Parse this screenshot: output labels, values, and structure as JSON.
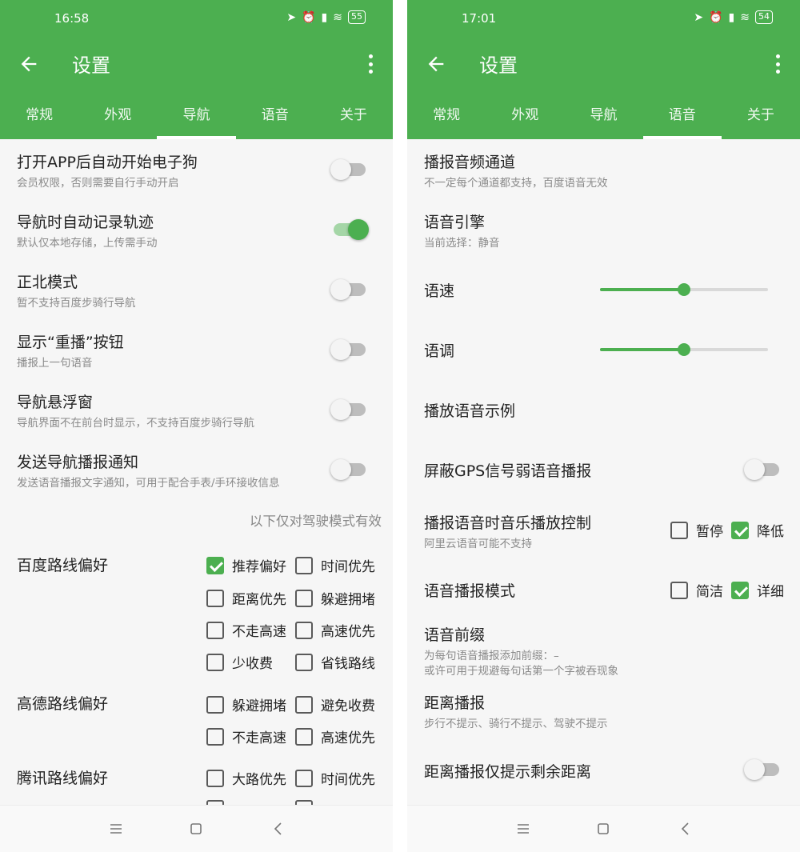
{
  "status": {
    "left_time": "16:58",
    "right_time": "17:01",
    "left_battery": "55",
    "right_battery": "54"
  },
  "appbar": {
    "title": "设置"
  },
  "tabs": [
    "常规",
    "外观",
    "导航",
    "语音",
    "关于"
  ],
  "colors": {
    "primary": "#4caf50",
    "background": "#f6f6f6",
    "text": "#222222",
    "subtext": "#8a8a8a"
  },
  "icons": {
    "back": "arrow-left-icon",
    "menu": "more-vert-icon",
    "nav_menu": "hamburger-icon",
    "nav_home": "square-icon",
    "nav_back": "chevron-left-icon"
  },
  "left": {
    "active_tab": "导航",
    "toggles": [
      {
        "title": "打开APP后自动开始电子狗",
        "subtitle": "会员权限，否则需要自行手动开启",
        "on": false
      },
      {
        "title": "导航时自动记录轨迹",
        "subtitle": "默认仅本地存储，上传需手动",
        "on": true
      },
      {
        "title": "正北模式",
        "subtitle": "暂不支持百度步骑行导航",
        "on": false
      },
      {
        "title": "显示“重播”按钮",
        "subtitle": "播报上一句语音",
        "on": false
      },
      {
        "title": "导航悬浮窗",
        "subtitle": "导航界面不在前台时显示，不支持百度步骑行导航",
        "on": false
      },
      {
        "title": "发送导航播报通知",
        "subtitle": "发送语音播报文字通知，可用于配合手表/手环接收信息",
        "on": false
      }
    ],
    "driving_note": "以下仅对驾驶模式有效",
    "baidu": {
      "label": "百度路线偏好",
      "options": [
        {
          "label": "推荐偏好",
          "checked": true
        },
        {
          "label": "时间优先",
          "checked": false
        },
        {
          "label": "距离优先",
          "checked": false
        },
        {
          "label": "躲避拥堵",
          "checked": false
        },
        {
          "label": "不走高速",
          "checked": false
        },
        {
          "label": "高速优先",
          "checked": false
        },
        {
          "label": "少收费",
          "checked": false
        },
        {
          "label": "省钱路线",
          "checked": false
        }
      ]
    },
    "gaode": {
      "label": "高德路线偏好",
      "options": [
        {
          "label": "躲避拥堵",
          "checked": false
        },
        {
          "label": "避免收费",
          "checked": false
        },
        {
          "label": "不走高速",
          "checked": false
        },
        {
          "label": "高速优先",
          "checked": false
        }
      ]
    },
    "tencent": {
      "label": "腾讯路线偏好",
      "options": [
        {
          "label": "大路优先",
          "checked": false
        },
        {
          "label": "时间优先",
          "checked": false
        }
      ]
    }
  },
  "right": {
    "active_tab": "语音",
    "audio_channel": {
      "title": "播报音频通道",
      "subtitle": "不一定每个通道都支持，百度语音无效"
    },
    "engine": {
      "title": "语音引擎",
      "subtitle": "当前选择：静音"
    },
    "speed": {
      "label": "语速",
      "value": 0.5
    },
    "pitch": {
      "label": "语调",
      "value": 0.5
    },
    "sample": {
      "title": "播放语音示例"
    },
    "gps_mute": {
      "title": "屏蔽GPS信号弱语音播报",
      "on": false
    },
    "music_control": {
      "title": "播报语音时音乐播放控制",
      "subtitle": "阿里云语音可能不支持",
      "options": [
        {
          "label": "暂停",
          "checked": false
        },
        {
          "label": "降低",
          "checked": true
        }
      ]
    },
    "mode": {
      "title": "语音播报模式",
      "options": [
        {
          "label": "简洁",
          "checked": false
        },
        {
          "label": "详细",
          "checked": true
        }
      ]
    },
    "prefix": {
      "title": "语音前缀",
      "subtitle1": "为每句语音播报添加前缀：–",
      "subtitle2": "或许可用于规避每句话第一个字被吞现象"
    },
    "distance": {
      "title": "距离播报",
      "subtitle": "步行不提示、骑行不提示、驾驶不提示"
    },
    "distance_remaining": {
      "title": "距离播报仅提示剩余距离",
      "on": false
    }
  }
}
